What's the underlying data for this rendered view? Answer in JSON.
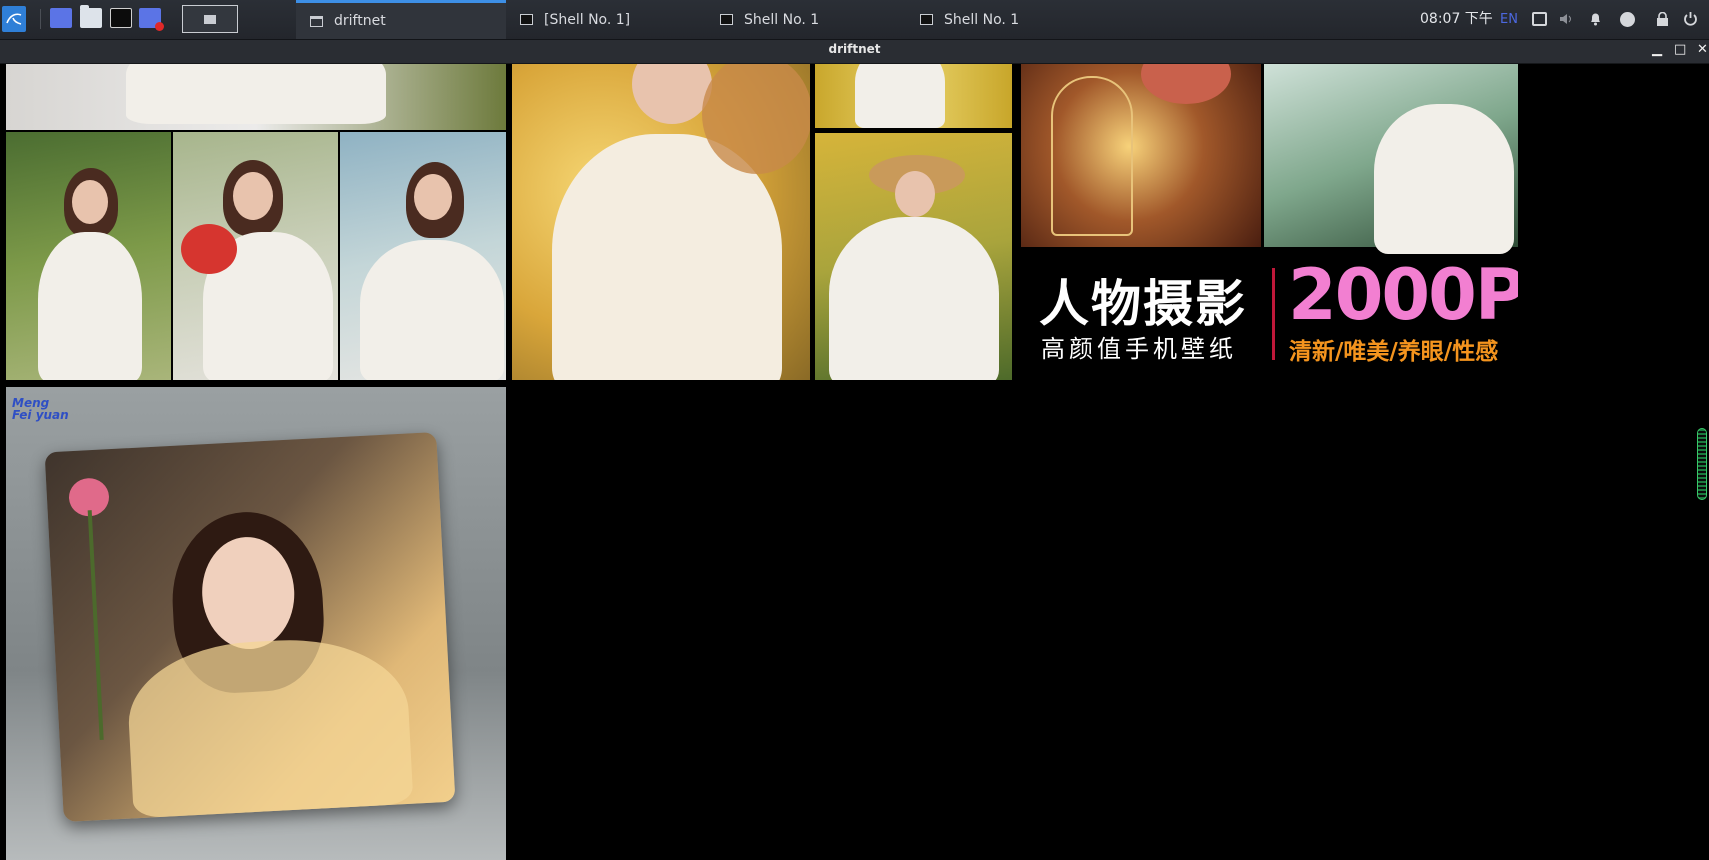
{
  "panel": {
    "launchers": [
      {
        "icon": "kali-menu-icon"
      },
      {
        "icon": "show-desktop-icon"
      },
      {
        "icon": "file-manager-icon"
      },
      {
        "icon": "terminal-icon"
      },
      {
        "icon": "screen-recorder-icon"
      }
    ],
    "tasks": [
      {
        "label": "driftnet",
        "icon": "window-icon",
        "active": true
      },
      {
        "label": "[Shell No. 1]",
        "icon": "terminal-window-icon",
        "active": false
      },
      {
        "label": "Shell No. 1",
        "icon": "terminal-window-icon",
        "active": false
      },
      {
        "label": "Shell No. 1",
        "icon": "terminal-window-icon",
        "active": false
      }
    ],
    "clock": "08:07 下午",
    "input_method": "EN",
    "tray_icons": [
      "display-icon",
      "volume-icon",
      "notification-bell-icon",
      "update-icon",
      "lock-icon",
      "power-icon"
    ]
  },
  "window": {
    "title": "driftnet",
    "controls": {
      "minimize": "▁",
      "maximize": "□",
      "close": "✕"
    }
  },
  "captured_images": {
    "banner": {
      "title_cn": "人物摄影",
      "subtitle_cn": "高颜值手机壁纸",
      "count": "2000P",
      "tags_cn": "清新/唯美/养眼/性感"
    },
    "pillow_logo": {
      "line1": "Meng",
      "line2": "Fei yuan"
    }
  },
  "colors": {
    "accent_blue": "#3d8fe6",
    "banner_pink": "#f27fd1",
    "banner_orange": "#f4941e",
    "banner_divider": "#c0183a",
    "background": "#000000"
  }
}
